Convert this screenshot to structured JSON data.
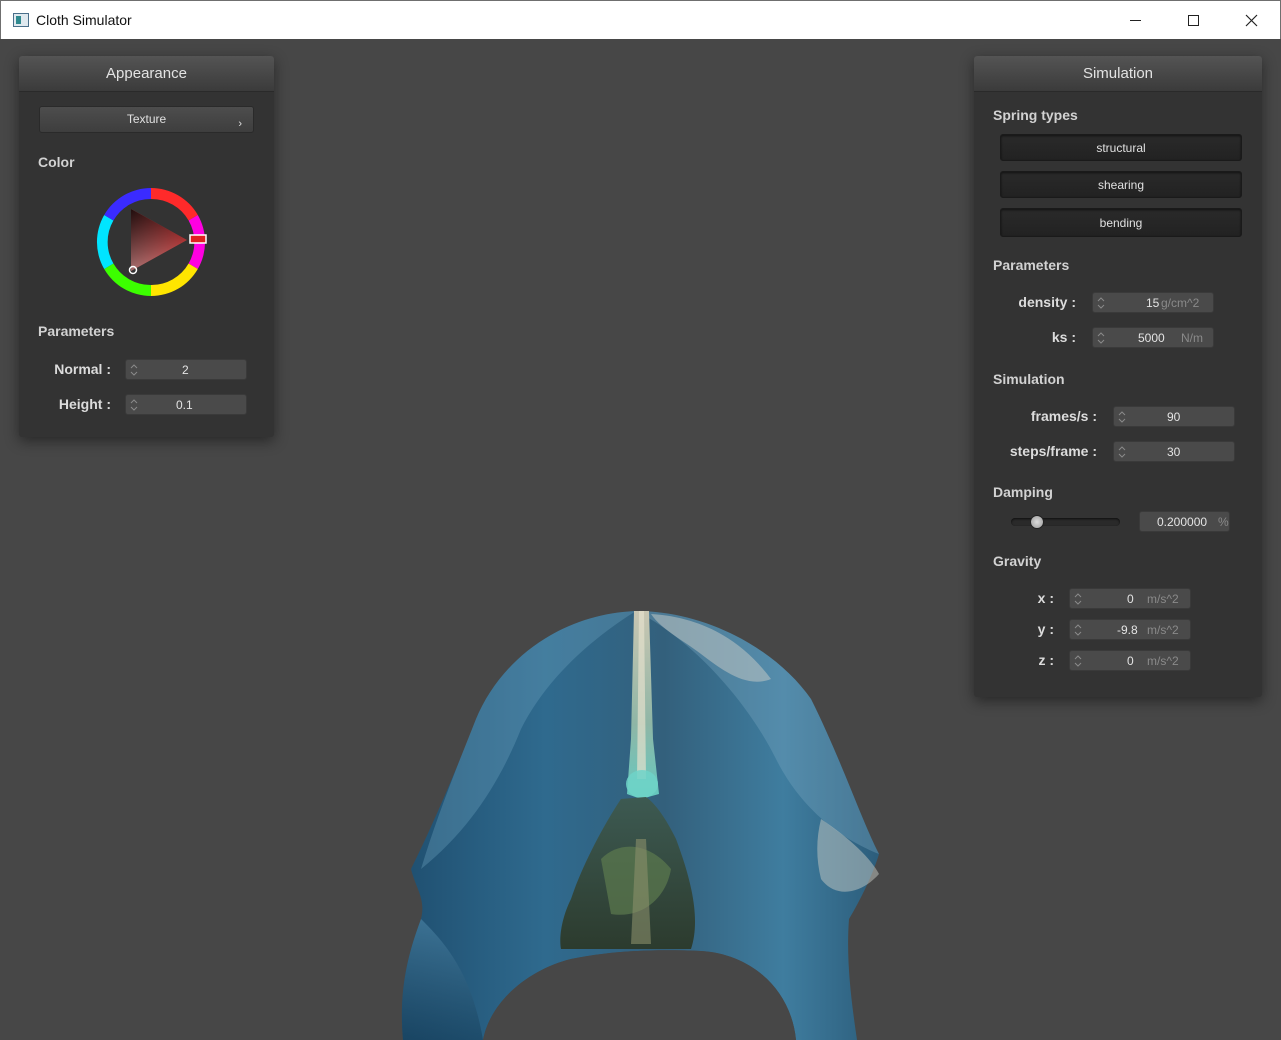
{
  "window": {
    "title": "Cloth Simulator"
  },
  "appearance": {
    "title": "Appearance",
    "texture_button": "Texture",
    "color_label": "Color",
    "color_value": "#c41e1e",
    "parameters_label": "Parameters",
    "normal_label": "Normal :",
    "normal_value": "2",
    "height_label": "Height :",
    "height_value": "0.1"
  },
  "simulation": {
    "title": "Simulation",
    "spring_types_label": "Spring types",
    "spring_types": [
      "structural",
      "shearing",
      "bending"
    ],
    "parameters_label": "Parameters",
    "density_label": "density :",
    "density_value": "15",
    "density_unit": "g/cm^2",
    "ks_label": "ks :",
    "ks_value": "5000",
    "ks_unit": "N/m",
    "simulation_label": "Simulation",
    "fps_label": "frames/s :",
    "fps_value": "90",
    "steps_label": "steps/frame :",
    "steps_value": "30",
    "damping_label": "Damping",
    "damping_value": "0.200000",
    "damping_unit": "%",
    "damping_fraction": 0.2,
    "gravity_label": "Gravity",
    "gx_label": "x :",
    "gx_value": "0",
    "gy_label": "y :",
    "gy_value": "-9.8",
    "gz_label": "z :",
    "gz_value": "0",
    "gravity_unit": "m/s^2"
  }
}
